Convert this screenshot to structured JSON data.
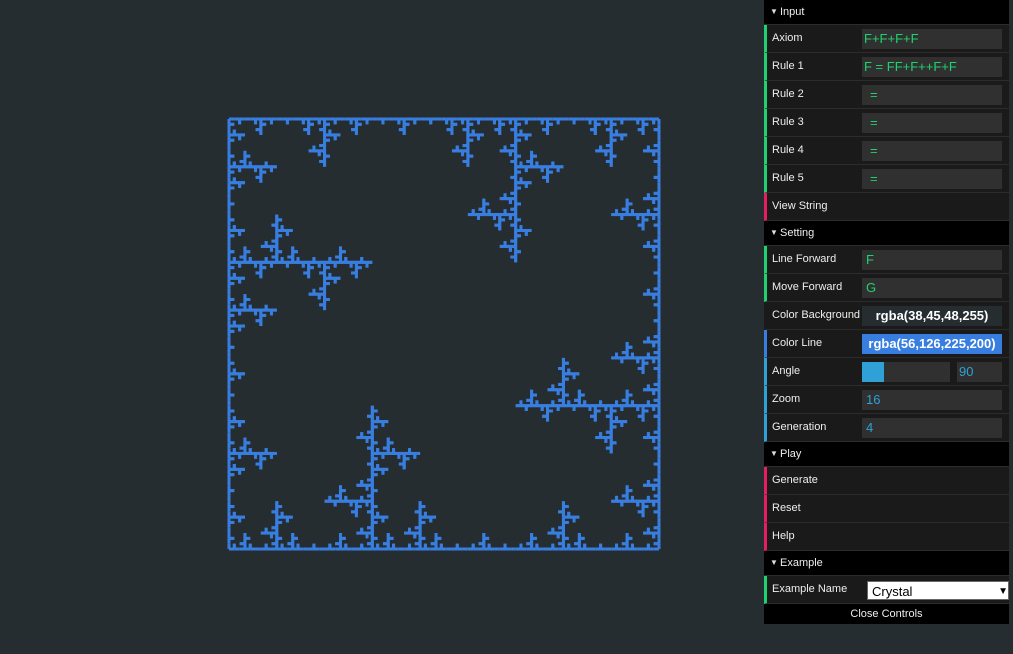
{
  "gui": {
    "input": {
      "title": "Input",
      "rows": [
        {
          "label": "Axiom",
          "value": "F+F+F+F"
        },
        {
          "label": "Rule 1",
          "value": "F = FF+F++F+F"
        },
        {
          "label": "Rule 2",
          "value": "="
        },
        {
          "label": "Rule 3",
          "value": "="
        },
        {
          "label": "Rule 4",
          "value": "="
        },
        {
          "label": "Rule 5",
          "value": "="
        }
      ],
      "view_string": "View String"
    },
    "setting": {
      "title": "Setting",
      "line_forward": {
        "label": "Line Forward",
        "value": "F"
      },
      "move_forward": {
        "label": "Move Forward",
        "value": "G"
      },
      "color_background": {
        "label": "Color Background",
        "value": "rgba(38,45,48,255)"
      },
      "color_line": {
        "label": "Color Line",
        "value": "rgba(56,126,225,200)"
      },
      "angle": {
        "label": "Angle",
        "value": "90",
        "fraction": 0.25
      },
      "zoom": {
        "label": "Zoom",
        "value": "16"
      },
      "generation": {
        "label": "Generation",
        "value": "4"
      }
    },
    "play": {
      "title": "Play",
      "generate": "Generate",
      "reset": "Reset",
      "help": "Help"
    },
    "example": {
      "title": "Example",
      "name_label": "Example Name",
      "name_value": "Crystal"
    },
    "close": "Close Controls"
  },
  "colors": {
    "background": "#262d30",
    "line": "#387ee1"
  }
}
